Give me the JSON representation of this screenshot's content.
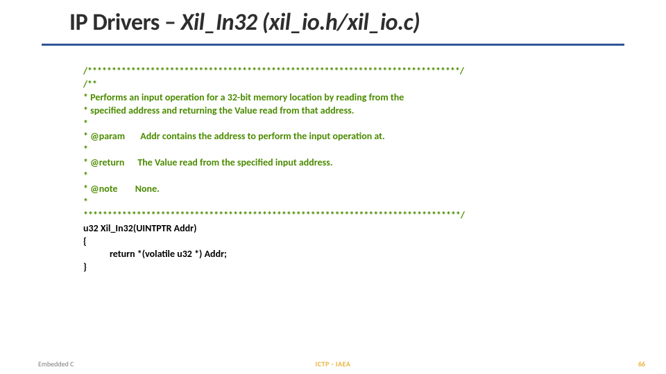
{
  "title": {
    "prefix": "IP Drivers – ",
    "ital": "Xil_In32 (xil_io.h/xil_io.c)"
  },
  "code": {
    "l01": "/*****************************************************************************/",
    "l02": "/**",
    "l03": "* Performs an input operation for a 32-bit memory location by reading from the",
    "l04": "* specified address and returning the Value read from that address.",
    "l05": "*",
    "l06": "* @param       Addr contains the address to perform the input operation at.",
    "l07": "*",
    "l08": "* @return      The Value read from the specified input address.",
    "l09": "*",
    "l10": "* @note        None.",
    "l11": "*",
    "l12": "******************************************************************************/",
    "l13a": "u32 ",
    "l13b": "Xil_In32",
    "l13c": "(UINTPTR Addr)",
    "l14": "{",
    "l15a": "            ",
    "l15b": "return *(volatile ",
    "l15c": "u32 *) Addr;",
    "l16": "}"
  },
  "footer": {
    "left": "Embedded C",
    "center": "ICTP - IAEA",
    "right": "66"
  }
}
